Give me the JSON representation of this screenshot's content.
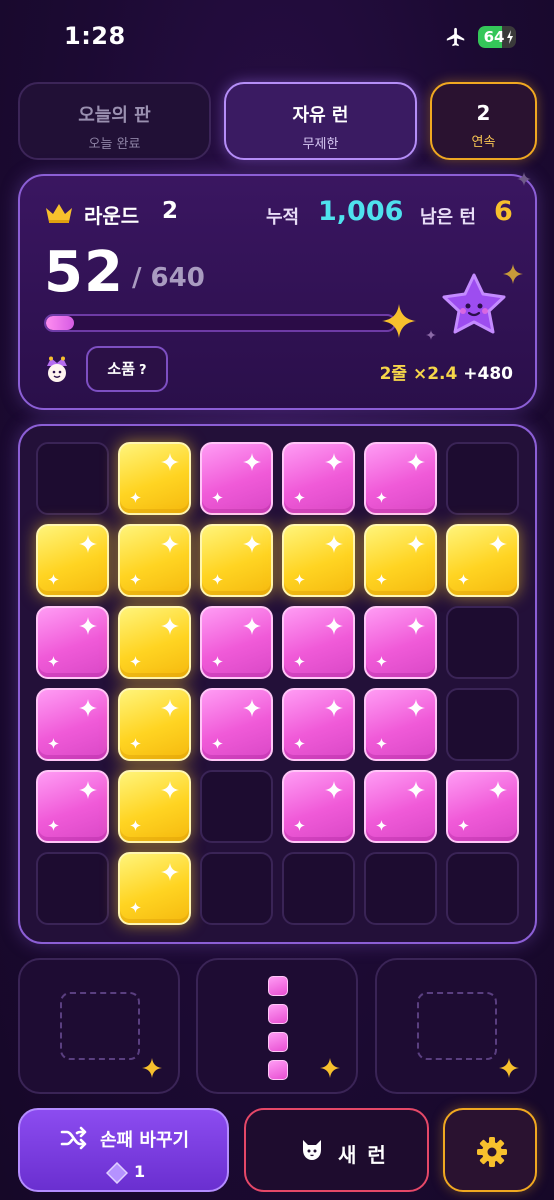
{
  "status": {
    "time": "1:28",
    "battery": "64",
    "battery_fraction": 0.64
  },
  "tabs": [
    {
      "title": "오늘의 판",
      "subtitle": "오늘 완료"
    },
    {
      "title": "자유 런",
      "subtitle": "무제한"
    },
    {
      "title": "2",
      "subtitle": "연속"
    }
  ],
  "info": {
    "round_label": "라운드",
    "round": "2",
    "total_label": "누적",
    "total": "1,006",
    "turns_label": "남은 턴",
    "turns": "6",
    "score": "52",
    "target": "/ 640",
    "progress_fraction": 0.081,
    "item_label": "소품",
    "item_hint": "?",
    "combo_text": "2줄 ×2.4",
    "combo_bonus": "+480"
  },
  "board": {
    "rows": 6,
    "cols": 6,
    "cells": [
      "empty",
      "yellow",
      "pink",
      "pink",
      "pink",
      "empty",
      "yellow",
      "yellow",
      "yellow",
      "yellow",
      "yellow",
      "yellow",
      "pink",
      "yellow",
      "pink",
      "pink",
      "pink",
      "empty",
      "pink",
      "yellow",
      "pink",
      "pink",
      "pink",
      "empty",
      "pink",
      "yellow",
      "empty",
      "pink",
      "pink",
      "pink",
      "empty",
      "yellow",
      "empty",
      "empty",
      "empty",
      "empty"
    ]
  },
  "tray": {
    "slots": [
      "empty",
      "vertical-4-pink",
      "empty"
    ]
  },
  "actions": {
    "shuffle_label": "손패 바꾸기",
    "shuffle_cost": "1",
    "new_run_label": "새 런"
  },
  "colors": {
    "accent": "#8c5fd6",
    "pink": "#f05ad8",
    "yellow": "#ffd422",
    "cyan": "#4fe2ee",
    "gold": "#f7c02d"
  },
  "icons": [
    "airplane-icon",
    "battery-icon",
    "crown-icon",
    "star-mascot-icon",
    "jester-icon",
    "shuffle-icon",
    "gem-icon",
    "cat-icon",
    "gear-icon",
    "sparkle-icon"
  ]
}
